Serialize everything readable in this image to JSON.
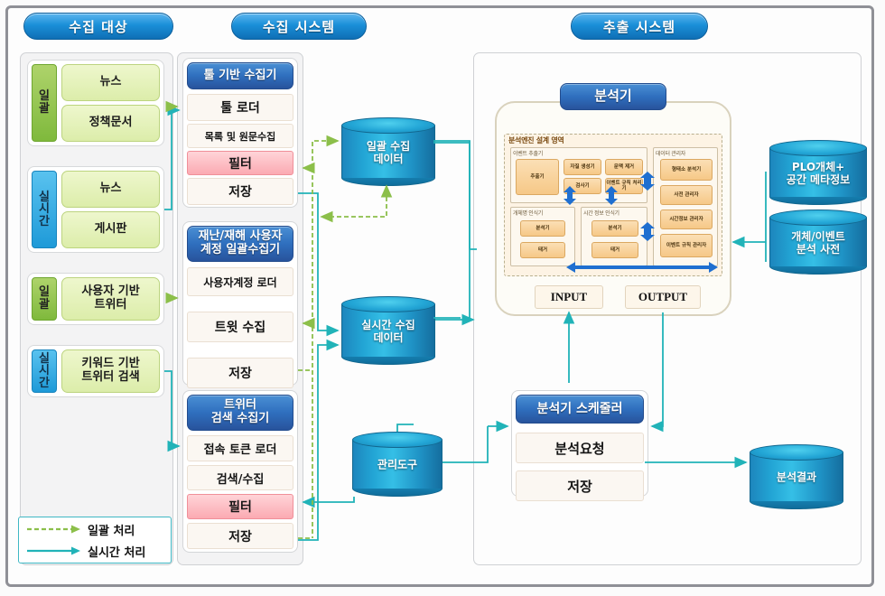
{
  "diagram": {
    "sections": [
      {
        "id": "collect-target",
        "title": "수집 대상"
      },
      {
        "id": "collect-system",
        "title": "수집 시스템"
      },
      {
        "id": "extract-system",
        "title": "추출 시스템"
      }
    ]
  },
  "sources": [
    {
      "tag": "일괄",
      "mode": "batch",
      "items": [
        "뉴스",
        "정책문서"
      ]
    },
    {
      "tag": "실시간",
      "mode": "realtime",
      "items": [
        "뉴스",
        "게시판"
      ]
    },
    {
      "tag": "일괄",
      "mode": "batch",
      "items": [
        "사용자 기반\n트위터"
      ]
    },
    {
      "tag": "실시간",
      "mode": "realtime",
      "items": [
        "키워드 기반\n트위터 검색"
      ]
    }
  ],
  "source_labels": {
    "s1_tag": "일괄",
    "s1_i1": "뉴스",
    "s1_i2": "정책문서",
    "s2_tag": "실시간",
    "s2_i1": "뉴스",
    "s2_i2": "게시판",
    "s3_tag": "일괄",
    "s3_i1": "사용자 기반 트위터",
    "s4_tag": "실시간",
    "s4_i1": "키워드 기반 트위터 검색"
  },
  "collectors": {
    "tool": {
      "title": "툴 기반 수집기",
      "rows": [
        "툴 로더",
        "목록 및 원문수집",
        "필터",
        "저장"
      ]
    },
    "disaster": {
      "title": "재난/재해 사용자\n계정 일괄수집기",
      "title_line1": "재난/재해 사용자",
      "title_line2": "계정 일괄수집기",
      "rows": [
        "사용자계정 로더",
        "트윗 수집",
        "저장"
      ]
    },
    "twitter": {
      "title_line1": "트위터",
      "title_line2": "검색 수집기",
      "rows": [
        "접속 토큰 로더",
        "검색/수집",
        "필터",
        "저장"
      ]
    }
  },
  "stores": {
    "batch": {
      "line1": "일괄 수집",
      "line2": "데이터"
    },
    "realtime": {
      "line1": "실시간 수집",
      "line2": "데이터"
    },
    "admin": {
      "line1": "관리도구",
      "line2": ""
    },
    "plo": {
      "line1": "PLO개체+",
      "line2": "공간 메타정보"
    },
    "dict": {
      "line1": "개체/이벤트",
      "line2": "분석 사전"
    },
    "result": {
      "line1": "분석결과",
      "line2": ""
    }
  },
  "analyzer": {
    "title": "분석기",
    "engine_title": "분석엔진 설계 영역",
    "panels": {
      "event_extractor": {
        "title": "이벤트 추출기",
        "chips": [
          "추출기",
          "자질 생성기",
          "문맥 제거",
          "검사기",
          "이벤트 규칙 처리기"
        ]
      },
      "entity_recognizer": {
        "title": "개체명 인식기",
        "chips": [
          "분석기",
          "태거"
        ]
      },
      "time_recognizer": {
        "title": "시간 정보 인식기",
        "chips": [
          "분석기",
          "태거"
        ]
      },
      "data_manager": {
        "title": "데이터 관리자",
        "chips": [
          "형태소 분석기",
          "사전 관리자",
          "시간정보 관리자",
          "이벤트 규칙 관리자"
        ]
      }
    },
    "io": {
      "input": "INPUT",
      "output": "OUTPUT"
    }
  },
  "scheduler": {
    "title": "분석기 스케줄러",
    "rows": [
      "분석요청",
      "저장"
    ]
  },
  "legend": {
    "batch": "일괄 처리",
    "realtime": "실시간 처리"
  },
  "colors": {
    "batch_flow": "#8cbf4a",
    "realtime_flow": "#21b3b8",
    "header_blue": "#1a8fd8",
    "module_header": "#2f6fbe",
    "filter_pink": "#fbaab2",
    "source_green": "#dcedaa",
    "cylinder": "#22a4d4"
  }
}
